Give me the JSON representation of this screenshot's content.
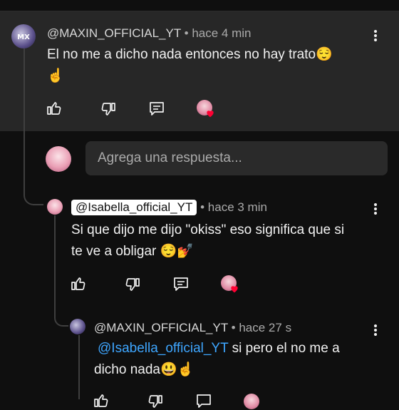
{
  "comment1": {
    "handle": "@MAXIN_OFFICIAL_YT",
    "time": "• hace 4 min",
    "text_line1": "El no me a dicho nada entonces no hay trato😌",
    "text_line2": "☝️"
  },
  "reply_input": {
    "placeholder": "Agrega una respuesta..."
  },
  "reply1": {
    "mention": "@Isabella_official_YT",
    "time": "• hace 3 min",
    "text_line1": "Si que dijo me dijo \"okiss\" eso significa que si",
    "text_line2": "te ve a obligar 😌💅"
  },
  "reply2": {
    "handle": "@MAXIN_OFFICIAL_YT",
    "time": "• hace 27 s",
    "mention": "@Isabella_official_YT",
    "text_after_mention": " si pero el no me a",
    "text_line2": "dicho nada😃☝️"
  },
  "icons": [
    "like-icon",
    "dislike-icon",
    "reply-icon",
    "creator-heart-icon",
    "more-options-icon"
  ],
  "colors": {
    "background": "#0f0f0f",
    "highlight": "#272727",
    "link": "#3ea6ff",
    "heart": "#ff0033"
  }
}
